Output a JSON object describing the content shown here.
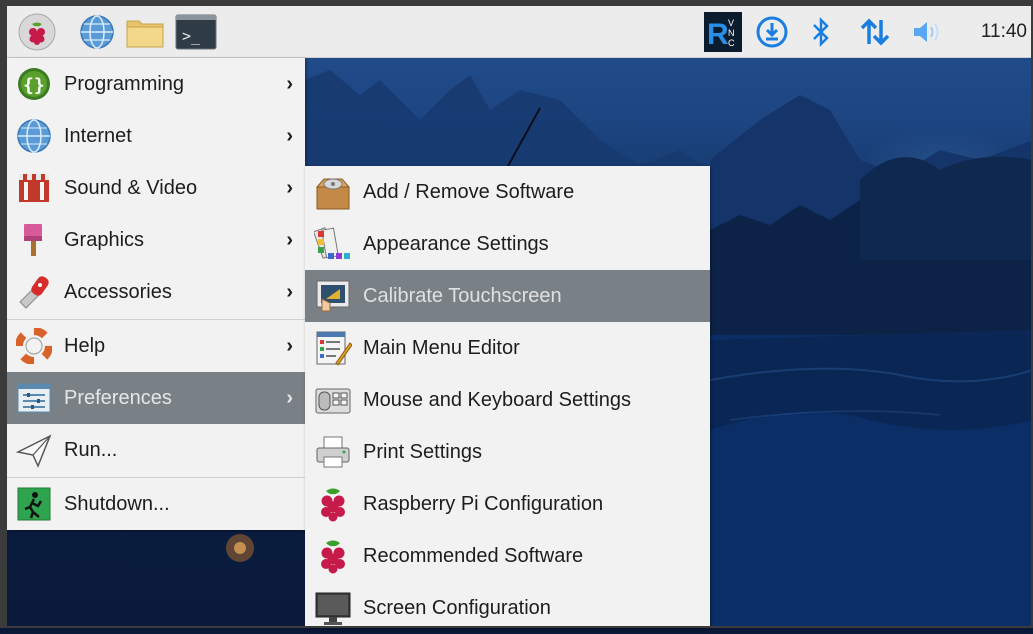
{
  "taskbar": {
    "launchers": [
      {
        "name": "raspberry-menu-icon"
      },
      {
        "name": "web-browser-icon"
      },
      {
        "name": "file-manager-icon"
      },
      {
        "name": "terminal-icon"
      }
    ],
    "tray": [
      "realvnc-icon",
      "updates-download-icon",
      "bluetooth-icon",
      "network-transfer-icon",
      "volume-icon"
    ],
    "clock": "11:40"
  },
  "menu": {
    "items": [
      {
        "label": "Programming",
        "icon": "programming-icon",
        "submenu": true
      },
      {
        "label": "Internet",
        "icon": "internet-globe-icon",
        "submenu": true
      },
      {
        "label": "Sound & Video",
        "icon": "sound-video-icon",
        "submenu": true
      },
      {
        "label": "Graphics",
        "icon": "graphics-paintbrush-icon",
        "submenu": true
      },
      {
        "label": "Accessories",
        "icon": "accessories-knife-icon",
        "submenu": true
      },
      {
        "label": "Help",
        "icon": "help-lifebuoy-icon",
        "submenu": true
      },
      {
        "label": "Preferences",
        "icon": "preferences-icon",
        "submenu": true,
        "selected": true
      },
      {
        "label": "Run...",
        "icon": "run-paperplane-icon",
        "submenu": false
      },
      {
        "label": "Shutdown...",
        "icon": "shutdown-exit-icon",
        "submenu": false
      }
    ],
    "arrow": "›"
  },
  "submenu": {
    "items": [
      {
        "label": "Add / Remove Software",
        "icon": "add-remove-software-icon"
      },
      {
        "label": "Appearance Settings",
        "icon": "appearance-settings-icon"
      },
      {
        "label": "Calibrate Touchscreen",
        "icon": "calibrate-touchscreen-icon",
        "highlighted": true
      },
      {
        "label": "Main Menu Editor",
        "icon": "menu-editor-icon"
      },
      {
        "label": "Mouse and Keyboard Settings",
        "icon": "mouse-keyboard-icon"
      },
      {
        "label": "Print Settings",
        "icon": "printer-icon"
      },
      {
        "label": "Raspberry Pi Configuration",
        "icon": "raspberry-config-icon"
      },
      {
        "label": "Recommended Software",
        "icon": "raspberry-recommended-icon"
      },
      {
        "label": "Screen Configuration",
        "icon": "monitor-icon"
      }
    ]
  },
  "colors": {
    "taskbar_bg": "#ececec",
    "menu_bg": "#f2f2f2",
    "selection": "#7a8186",
    "tray_blue": "#1a7ee0"
  }
}
